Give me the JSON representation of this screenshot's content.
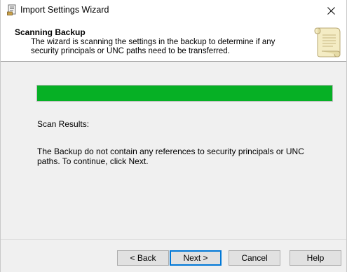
{
  "window": {
    "title": "Import Settings Wizard"
  },
  "header": {
    "title": "Scanning Backup",
    "description": "The wizard is scanning the settings in the backup to determine if any security principals or UNC paths need to be transferred."
  },
  "progress": {
    "fraction": 1.0,
    "color": "#06b025"
  },
  "results": {
    "label": "Scan Results:",
    "message": "The Backup do not contain any references to security principals or UNC paths. To continue, click Next."
  },
  "buttons": {
    "back": "< Back",
    "next": "Next >",
    "cancel": "Cancel",
    "help": "Help"
  },
  "icons": {
    "app": "wizard-app-icon",
    "header": "scroll-icon",
    "close": "close-icon"
  }
}
